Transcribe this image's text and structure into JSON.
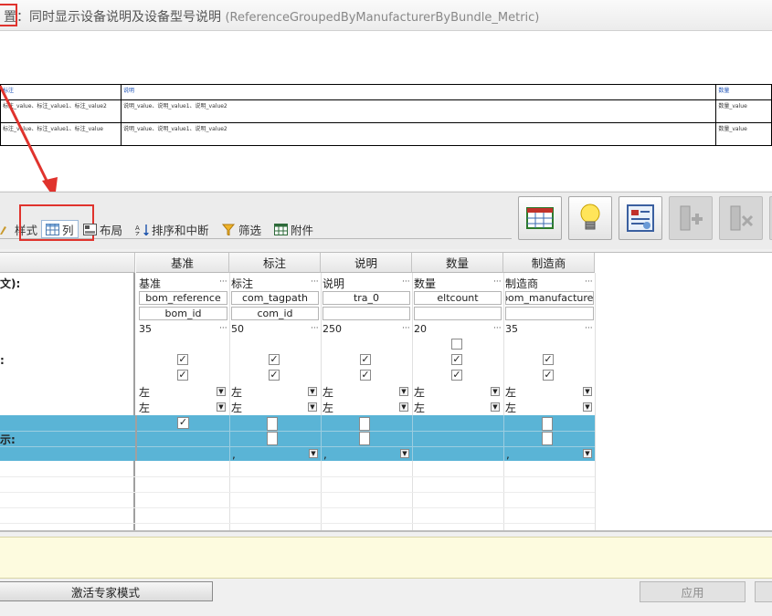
{
  "window": {
    "title_prefix": "置：",
    "title_cn": "同时显示设备说明及设备型号说明",
    "title_en": "(ReferenceGroupedByManufacturerByBundle_Metric)"
  },
  "preview": {
    "headers": [
      "标注",
      "说明",
      "数量"
    ],
    "rows": [
      [
        "标注_value、标注_value1、标注_value2",
        "说明_value、说明_value1、说明_value2",
        "数量_value"
      ],
      [
        "标注_value、标注_value1、标注_value",
        "说明_value、说明_value1、说明_value2",
        "数量_value"
      ]
    ]
  },
  "toolbar": {
    "tabs": [
      {
        "label": "样式",
        "icon": "brush-icon"
      },
      {
        "label": "列",
        "icon": "table-columns-icon"
      },
      {
        "label": "布局",
        "icon": "layout-icon"
      },
      {
        "label": "排序和中断",
        "icon": "sort-az-icon"
      },
      {
        "label": "筛选",
        "icon": "funnel-icon"
      },
      {
        "label": "附件",
        "icon": "attachment-table-icon"
      }
    ],
    "buttons": [
      {
        "icon": "table-grid-icon"
      },
      {
        "icon": "lightbulb-icon"
      },
      {
        "icon": "properties-form-icon"
      },
      {
        "icon": "add-column-icon"
      },
      {
        "icon": "remove-column-icon"
      }
    ]
  },
  "grid": {
    "column_headers": [
      "基准",
      "标注",
      "说明",
      "数量",
      "制造商"
    ],
    "row_labels": [
      "文):",
      "",
      "",
      "",
      "",
      ":",
      "",
      "",
      "",
      "",
      "示:",
      ""
    ],
    "names": [
      "基准",
      "标注",
      "说明",
      "数量",
      "制造商"
    ],
    "fields": [
      "bom_reference",
      "com_tagpath",
      "tra_0",
      "eltcount",
      "bom_manufacturer"
    ],
    "fields2": [
      "bom_id",
      "com_id",
      "",
      "",
      ""
    ],
    "widths": [
      "35",
      "50",
      "250",
      "20",
      "35"
    ],
    "align1": [
      "左",
      "左",
      "左",
      "左",
      "左"
    ],
    "align2": [
      "左",
      "左",
      "左",
      "左",
      "左"
    ],
    "sep": [
      "",
      ",",
      ",",
      "",
      ","
    ],
    "ellipsis": "···"
  },
  "footer": {
    "expert_mode": "激活专家模式",
    "apply": "应用"
  }
}
